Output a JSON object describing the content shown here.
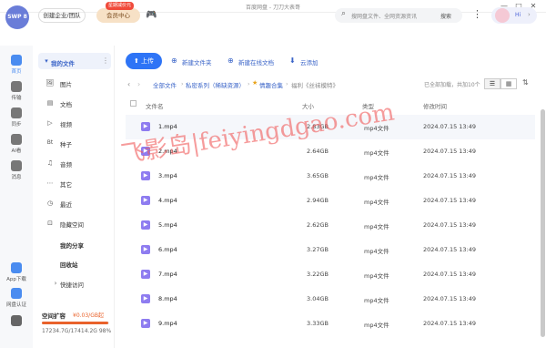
{
  "window": {
    "title": "百度网盘 - 刀刀大表哥",
    "controls": [
      "—",
      "□",
      "✕"
    ]
  },
  "header": {
    "logo_text": "SWP 8",
    "enterprise_label": "创建企业/团队",
    "vip_label": "会员中心",
    "vip_badge": "星期减价元",
    "search_placeholder": "搜网盘文件、全网资源资讯",
    "search_button": "搜索",
    "greeting": "Hi"
  },
  "rail": [
    {
      "label": "首页",
      "color": "#4a8cf0"
    },
    {
      "label": "传输",
      "color": "#777777"
    },
    {
      "label": "同步",
      "color": "#777777"
    },
    {
      "label": "AI看",
      "color": "#777777"
    },
    {
      "label": "消息",
      "color": "#777777"
    },
    {
      "label": "App下载",
      "color": "#4a8cf0"
    },
    {
      "label": "网盘认证",
      "color": "#4a8cf0"
    },
    {
      "label": "",
      "color": "#666666"
    }
  ],
  "sidebar": {
    "my_files": "我的文件",
    "items": [
      {
        "label": "图片",
        "icon": "🖼"
      },
      {
        "label": "文档",
        "icon": "▤"
      },
      {
        "label": "视频",
        "icon": "▷"
      },
      {
        "label": "种子",
        "icon": "Bt"
      },
      {
        "label": "音频",
        "icon": "♫"
      },
      {
        "label": "其它",
        "icon": "⋯"
      },
      {
        "label": "最近",
        "icon": "◷"
      },
      {
        "label": "隐藏空间",
        "icon": "⊡"
      }
    ],
    "my_share": "我的分享",
    "recycle": "回收站",
    "quick_access": "快捷访问",
    "quota_title": "空间扩容",
    "quota_price": "¥0.03/GB起",
    "quota_text": "17234.7G/17414.2G 98%",
    "quota_fraction": 0.98
  },
  "toolbar": {
    "upload": "上传",
    "new_folder": "新建文件夹",
    "new_doc": "新建在线文档",
    "offline": "云添加"
  },
  "breadcrumb": {
    "items": [
      "全部文件",
      "私密系列（稀缺资源）",
      "情趣合集",
      "福利《丝袜模特》"
    ],
    "loaded": "已全部加载，共加10个"
  },
  "table": {
    "headers": {
      "name": "文件名",
      "size": "大小",
      "type": "类型",
      "date": "修改时间"
    },
    "rows": [
      {
        "name": "1.mp4",
        "size": "2.83GB",
        "type": "mp4文件",
        "date": "2024.07.15 13:49"
      },
      {
        "name": "2.mp4",
        "size": "2.64GB",
        "type": "mp4文件",
        "date": "2024.07.15 13:49"
      },
      {
        "name": "3.mp4",
        "size": "3.65GB",
        "type": "mp4文件",
        "date": "2024.07.15 13:49"
      },
      {
        "name": "4.mp4",
        "size": "2.94GB",
        "type": "mp4文件",
        "date": "2024.07.15 13:49"
      },
      {
        "name": "5.mp4",
        "size": "2.62GB",
        "type": "mp4文件",
        "date": "2024.07.15 13:49"
      },
      {
        "name": "6.mp4",
        "size": "3.27GB",
        "type": "mp4文件",
        "date": "2024.07.15 13:49"
      },
      {
        "name": "7.mp4",
        "size": "3.22GB",
        "type": "mp4文件",
        "date": "2024.07.15 13:49"
      },
      {
        "name": "8.mp4",
        "size": "3.04GB",
        "type": "mp4文件",
        "date": "2024.07.15 13:49"
      },
      {
        "name": "9.mp4",
        "size": "3.33GB",
        "type": "mp4文件",
        "date": "2024.07.15 13:49"
      }
    ]
  },
  "watermark": "飞影岛|feiyingdgao.com"
}
